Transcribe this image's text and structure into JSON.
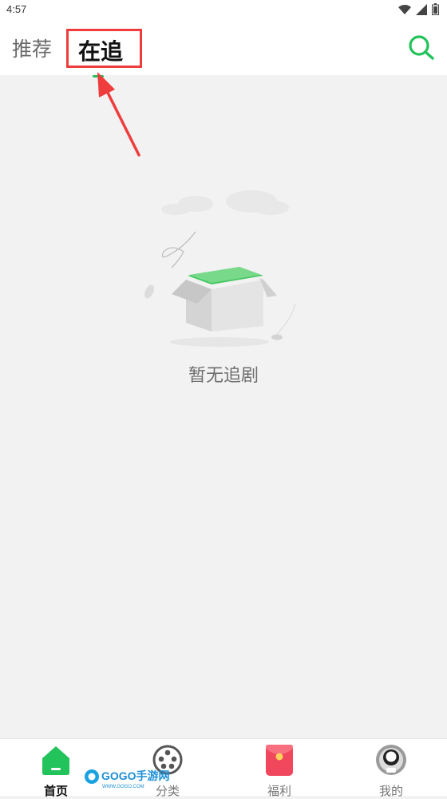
{
  "status_bar": {
    "time": "4:57",
    "icons": [
      "wifi-icon",
      "signal-icon",
      "battery-icon"
    ]
  },
  "top_nav": {
    "tabs": [
      {
        "label": "推荐",
        "active": false
      },
      {
        "label": "在追",
        "active": true
      }
    ],
    "search_icon": "search-icon"
  },
  "colors": {
    "accent": "#22c35a",
    "annotation": "#ef3c3c",
    "background": "#f2f2f2"
  },
  "empty_state": {
    "message": "暂无追剧",
    "illustration": "empty-box-illustration"
  },
  "bottom_nav": {
    "items": [
      {
        "label": "首页",
        "icon": "home-icon",
        "active": true
      },
      {
        "label": "分类",
        "icon": "category-icon",
        "active": false
      },
      {
        "label": "福利",
        "icon": "red-envelope-icon",
        "active": false
      },
      {
        "label": "我的",
        "icon": "profile-icon",
        "active": false
      }
    ]
  },
  "watermark": {
    "brand": "GOGO手游网",
    "sub": "WWW.GOGO.COM"
  }
}
